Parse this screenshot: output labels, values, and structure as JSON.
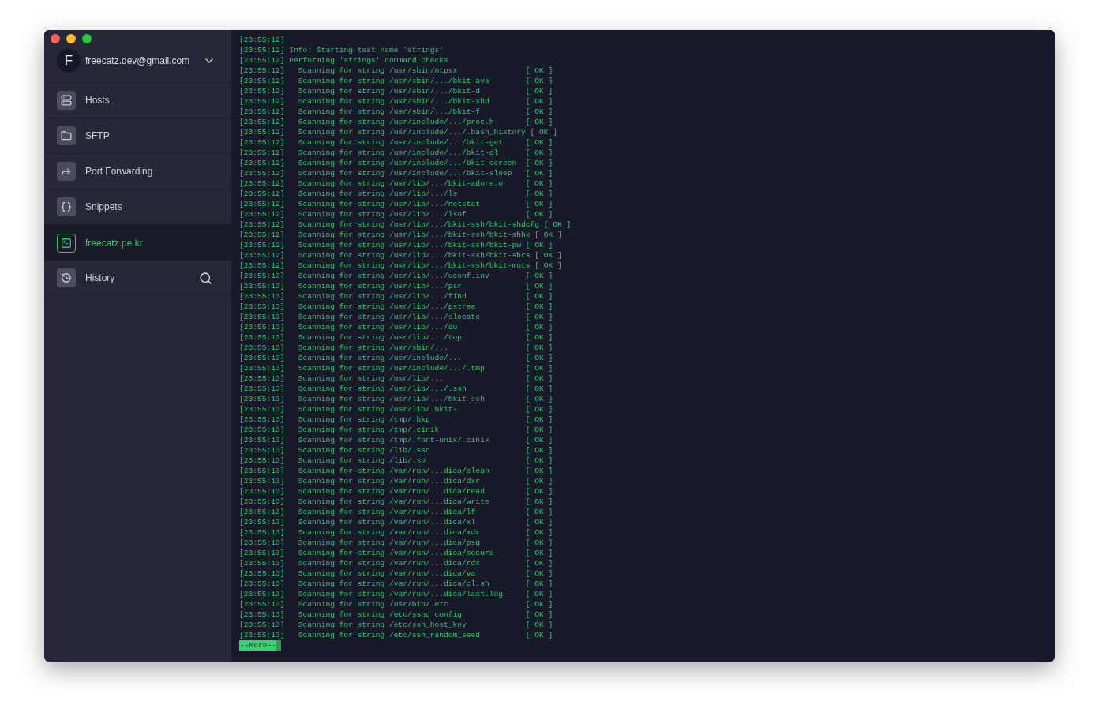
{
  "account": {
    "initial": "F",
    "email": "freecatz.dev@gmail.com"
  },
  "nav": [
    {
      "kind": "hosts",
      "label": "Hosts",
      "selected": false
    },
    {
      "kind": "sftp",
      "label": "SFTP",
      "selected": false
    },
    {
      "kind": "forwarding",
      "label": "Port Forwarding",
      "selected": false
    },
    {
      "kind": "snippets",
      "label": "Snippets",
      "selected": false
    },
    {
      "kind": "terminal",
      "label": "freecatz.pe.kr",
      "selected": true
    },
    {
      "kind": "history",
      "label": "History",
      "selected": false
    }
  ],
  "terminal": {
    "lines": [
      {
        "time": "[23:55:12]",
        "kind": "blank"
      },
      {
        "time": "[23:55:12]",
        "kind": "info",
        "text": "Info: Starting test name 'strings'"
      },
      {
        "time": "[23:55:12]",
        "kind": "info",
        "text": "Performing 'strings' command checks"
      },
      {
        "time": "[23:55:12]",
        "kind": "scan",
        "text": "Scanning for string /usr/sbin/ntpsx",
        "status": "[ OK ]"
      },
      {
        "time": "[23:55:12]",
        "kind": "scan",
        "text": "Scanning for string /usr/sbin/.../bkit-ava",
        "status": "[ OK ]"
      },
      {
        "time": "[23:55:12]",
        "kind": "scan",
        "text": "Scanning for string /usr/sbin/.../bkit-d",
        "status": "[ OK ]"
      },
      {
        "time": "[23:55:12]",
        "kind": "scan",
        "text": "Scanning for string /usr/sbin/.../bkit-shd",
        "status": "[ OK ]"
      },
      {
        "time": "[23:55:12]",
        "kind": "scan",
        "text": "Scanning for string /usr/sbin/.../bkit-f",
        "status": "[ OK ]"
      },
      {
        "time": "[23:55:12]",
        "kind": "scan",
        "text": "Scanning for string /usr/include/.../proc.h",
        "status": "[ OK ]"
      },
      {
        "time": "[23:55:12]",
        "kind": "scan",
        "text": "Scanning for string /usr/include/.../.bash_history",
        "status": "[ OK ]"
      },
      {
        "time": "[23:55:12]",
        "kind": "scan",
        "text": "Scanning for string /usr/include/.../bkit-get",
        "status": "[ OK ]"
      },
      {
        "time": "[23:55:12]",
        "kind": "scan",
        "text": "Scanning for string /usr/include/.../bkit-dl",
        "status": "[ OK ]"
      },
      {
        "time": "[23:55:12]",
        "kind": "scan",
        "text": "Scanning for string /usr/include/.../bkit-screen",
        "status": "[ OK ]"
      },
      {
        "time": "[23:55:12]",
        "kind": "scan",
        "text": "Scanning for string /usr/include/.../bkit-sleep",
        "status": "[ OK ]"
      },
      {
        "time": "[23:55:12]",
        "kind": "scan",
        "text": "Scanning for string /usr/lib/.../bkit-adore.o",
        "status": "[ OK ]"
      },
      {
        "time": "[23:55:12]",
        "kind": "scan",
        "text": "Scanning for string /usr/lib/.../ls",
        "status": "[ OK ]"
      },
      {
        "time": "[23:55:12]",
        "kind": "scan",
        "text": "Scanning for string /usr/lib/.../netstat",
        "status": "[ OK ]"
      },
      {
        "time": "[23:55:12]",
        "kind": "scan",
        "text": "Scanning for string /usr/lib/.../lsof",
        "status": "[ OK ]"
      },
      {
        "time": "[23:55:12]",
        "kind": "scan",
        "text": "Scanning for string /usr/lib/.../bkit-ssh/bkit-shdcfg",
        "status": "[ OK ]"
      },
      {
        "time": "[23:55:12]",
        "kind": "scan",
        "text": "Scanning for string /usr/lib/.../bkit-ssh/bkit-shhk",
        "status": "[ OK ]"
      },
      {
        "time": "[23:55:12]",
        "kind": "scan",
        "text": "Scanning for string /usr/lib/.../bkit-ssh/bkit-pw",
        "status": "[ OK ]"
      },
      {
        "time": "[23:55:12]",
        "kind": "scan",
        "text": "Scanning for string /usr/lib/.../bkit-ssh/bkit-shrs",
        "status": "[ OK ]"
      },
      {
        "time": "[23:55:12]",
        "kind": "scan",
        "text": "Scanning for string /usr/lib/.../bkit-ssh/bkit-mots",
        "status": "[ OK ]"
      },
      {
        "time": "[23:55:13]",
        "kind": "scan",
        "text": "Scanning for string /usr/lib/.../uconf.inv",
        "status": "[ OK ]"
      },
      {
        "time": "[23:55:13]",
        "kind": "scan",
        "text": "Scanning for string /usr/lib/.../psr",
        "status": "[ OK ]"
      },
      {
        "time": "[23:55:13]",
        "kind": "scan",
        "text": "Scanning for string /usr/lib/.../find",
        "status": "[ OK ]"
      },
      {
        "time": "[23:55:13]",
        "kind": "scan",
        "text": "Scanning for string /usr/lib/.../pstree",
        "status": "[ OK ]"
      },
      {
        "time": "[23:55:13]",
        "kind": "scan",
        "text": "Scanning for string /usr/lib/.../slocate",
        "status": "[ OK ]"
      },
      {
        "time": "[23:55:13]",
        "kind": "scan",
        "text": "Scanning for string /usr/lib/.../du",
        "status": "[ OK ]"
      },
      {
        "time": "[23:55:13]",
        "kind": "scan",
        "text": "Scanning for string /usr/lib/.../top",
        "status": "[ OK ]"
      },
      {
        "time": "[23:55:13]",
        "kind": "scan",
        "text": "Scanning for string /usr/sbin/...",
        "status": "[ OK ]"
      },
      {
        "time": "[23:55:13]",
        "kind": "scan",
        "text": "Scanning for string /usr/include/...",
        "status": "[ OK ]"
      },
      {
        "time": "[23:55:13]",
        "kind": "scan",
        "text": "Scanning for string /usr/include/.../.tmp",
        "status": "[ OK ]"
      },
      {
        "time": "[23:55:13]",
        "kind": "scan",
        "text": "Scanning for string /usr/lib/...",
        "status": "[ OK ]"
      },
      {
        "time": "[23:55:13]",
        "kind": "scan",
        "text": "Scanning for string /usr/lib/.../.ssh",
        "status": "[ OK ]"
      },
      {
        "time": "[23:55:13]",
        "kind": "scan",
        "text": "Scanning for string /usr/lib/.../bkit-ssh",
        "status": "[ OK ]"
      },
      {
        "time": "[23:55:13]",
        "kind": "scan",
        "text": "Scanning for string /usr/lib/.bkit-",
        "status": "[ OK ]"
      },
      {
        "time": "[23:55:13]",
        "kind": "scan",
        "text": "Scanning for string /tmp/.bkp",
        "status": "[ OK ]"
      },
      {
        "time": "[23:55:13]",
        "kind": "scan",
        "text": "Scanning for string /tmp/.cinik",
        "status": "[ OK ]"
      },
      {
        "time": "[23:55:13]",
        "kind": "scan",
        "text": "Scanning for string /tmp/.font-unix/.cinik",
        "status": "[ OK ]"
      },
      {
        "time": "[23:55:13]",
        "kind": "scan",
        "text": "Scanning for string /lib/.sso",
        "status": "[ OK ]"
      },
      {
        "time": "[23:55:13]",
        "kind": "scan",
        "text": "Scanning for string /lib/.so",
        "status": "[ OK ]"
      },
      {
        "time": "[23:55:13]",
        "kind": "scan",
        "text": "Scanning for string /var/run/...dica/clean",
        "status": "[ OK ]"
      },
      {
        "time": "[23:55:13]",
        "kind": "scan",
        "text": "Scanning for string /var/run/...dica/dxr",
        "status": "[ OK ]"
      },
      {
        "time": "[23:55:13]",
        "kind": "scan",
        "text": "Scanning for string /var/run/...dica/read",
        "status": "[ OK ]"
      },
      {
        "time": "[23:55:13]",
        "kind": "scan",
        "text": "Scanning for string /var/run/...dica/write",
        "status": "[ OK ]"
      },
      {
        "time": "[23:55:13]",
        "kind": "scan",
        "text": "Scanning for string /var/run/...dica/lf",
        "status": "[ OK ]"
      },
      {
        "time": "[23:55:13]",
        "kind": "scan",
        "text": "Scanning for string /var/run/...dica/xl",
        "status": "[ OK ]"
      },
      {
        "time": "[23:55:13]",
        "kind": "scan",
        "text": "Scanning for string /var/run/...dica/xdr",
        "status": "[ OK ]"
      },
      {
        "time": "[23:55:13]",
        "kind": "scan",
        "text": "Scanning for string /var/run/...dica/psg",
        "status": "[ OK ]"
      },
      {
        "time": "[23:55:13]",
        "kind": "scan",
        "text": "Scanning for string /var/run/...dica/secure",
        "status": "[ OK ]"
      },
      {
        "time": "[23:55:13]",
        "kind": "scan",
        "text": "Scanning for string /var/run/...dica/rdx",
        "status": "[ OK ]"
      },
      {
        "time": "[23:55:13]",
        "kind": "scan",
        "text": "Scanning for string /var/run/...dica/va",
        "status": "[ OK ]"
      },
      {
        "time": "[23:55:13]",
        "kind": "scan",
        "text": "Scanning for string /var/run/...dica/cl.sh",
        "status": "[ OK ]"
      },
      {
        "time": "[23:55:13]",
        "kind": "scan",
        "text": "Scanning for string /var/run/...dica/last.log",
        "status": "[ OK ]"
      },
      {
        "time": "[23:55:13]",
        "kind": "scan",
        "text": "Scanning for string /usr/bin/.etc",
        "status": "[ OK ]"
      },
      {
        "time": "[23:55:13]",
        "kind": "scan",
        "text": "Scanning for string /etc/sshd_config",
        "status": "[ OK ]"
      },
      {
        "time": "[23:55:13]",
        "kind": "scan",
        "text": "Scanning for string /etc/ssh_host_key",
        "status": "[ OK ]"
      },
      {
        "time": "[23:55:13]",
        "kind": "scan",
        "text": "Scanning for string /etc/ssh_random_seed",
        "status": "[ OK ]"
      }
    ],
    "prompt": "--More--"
  }
}
